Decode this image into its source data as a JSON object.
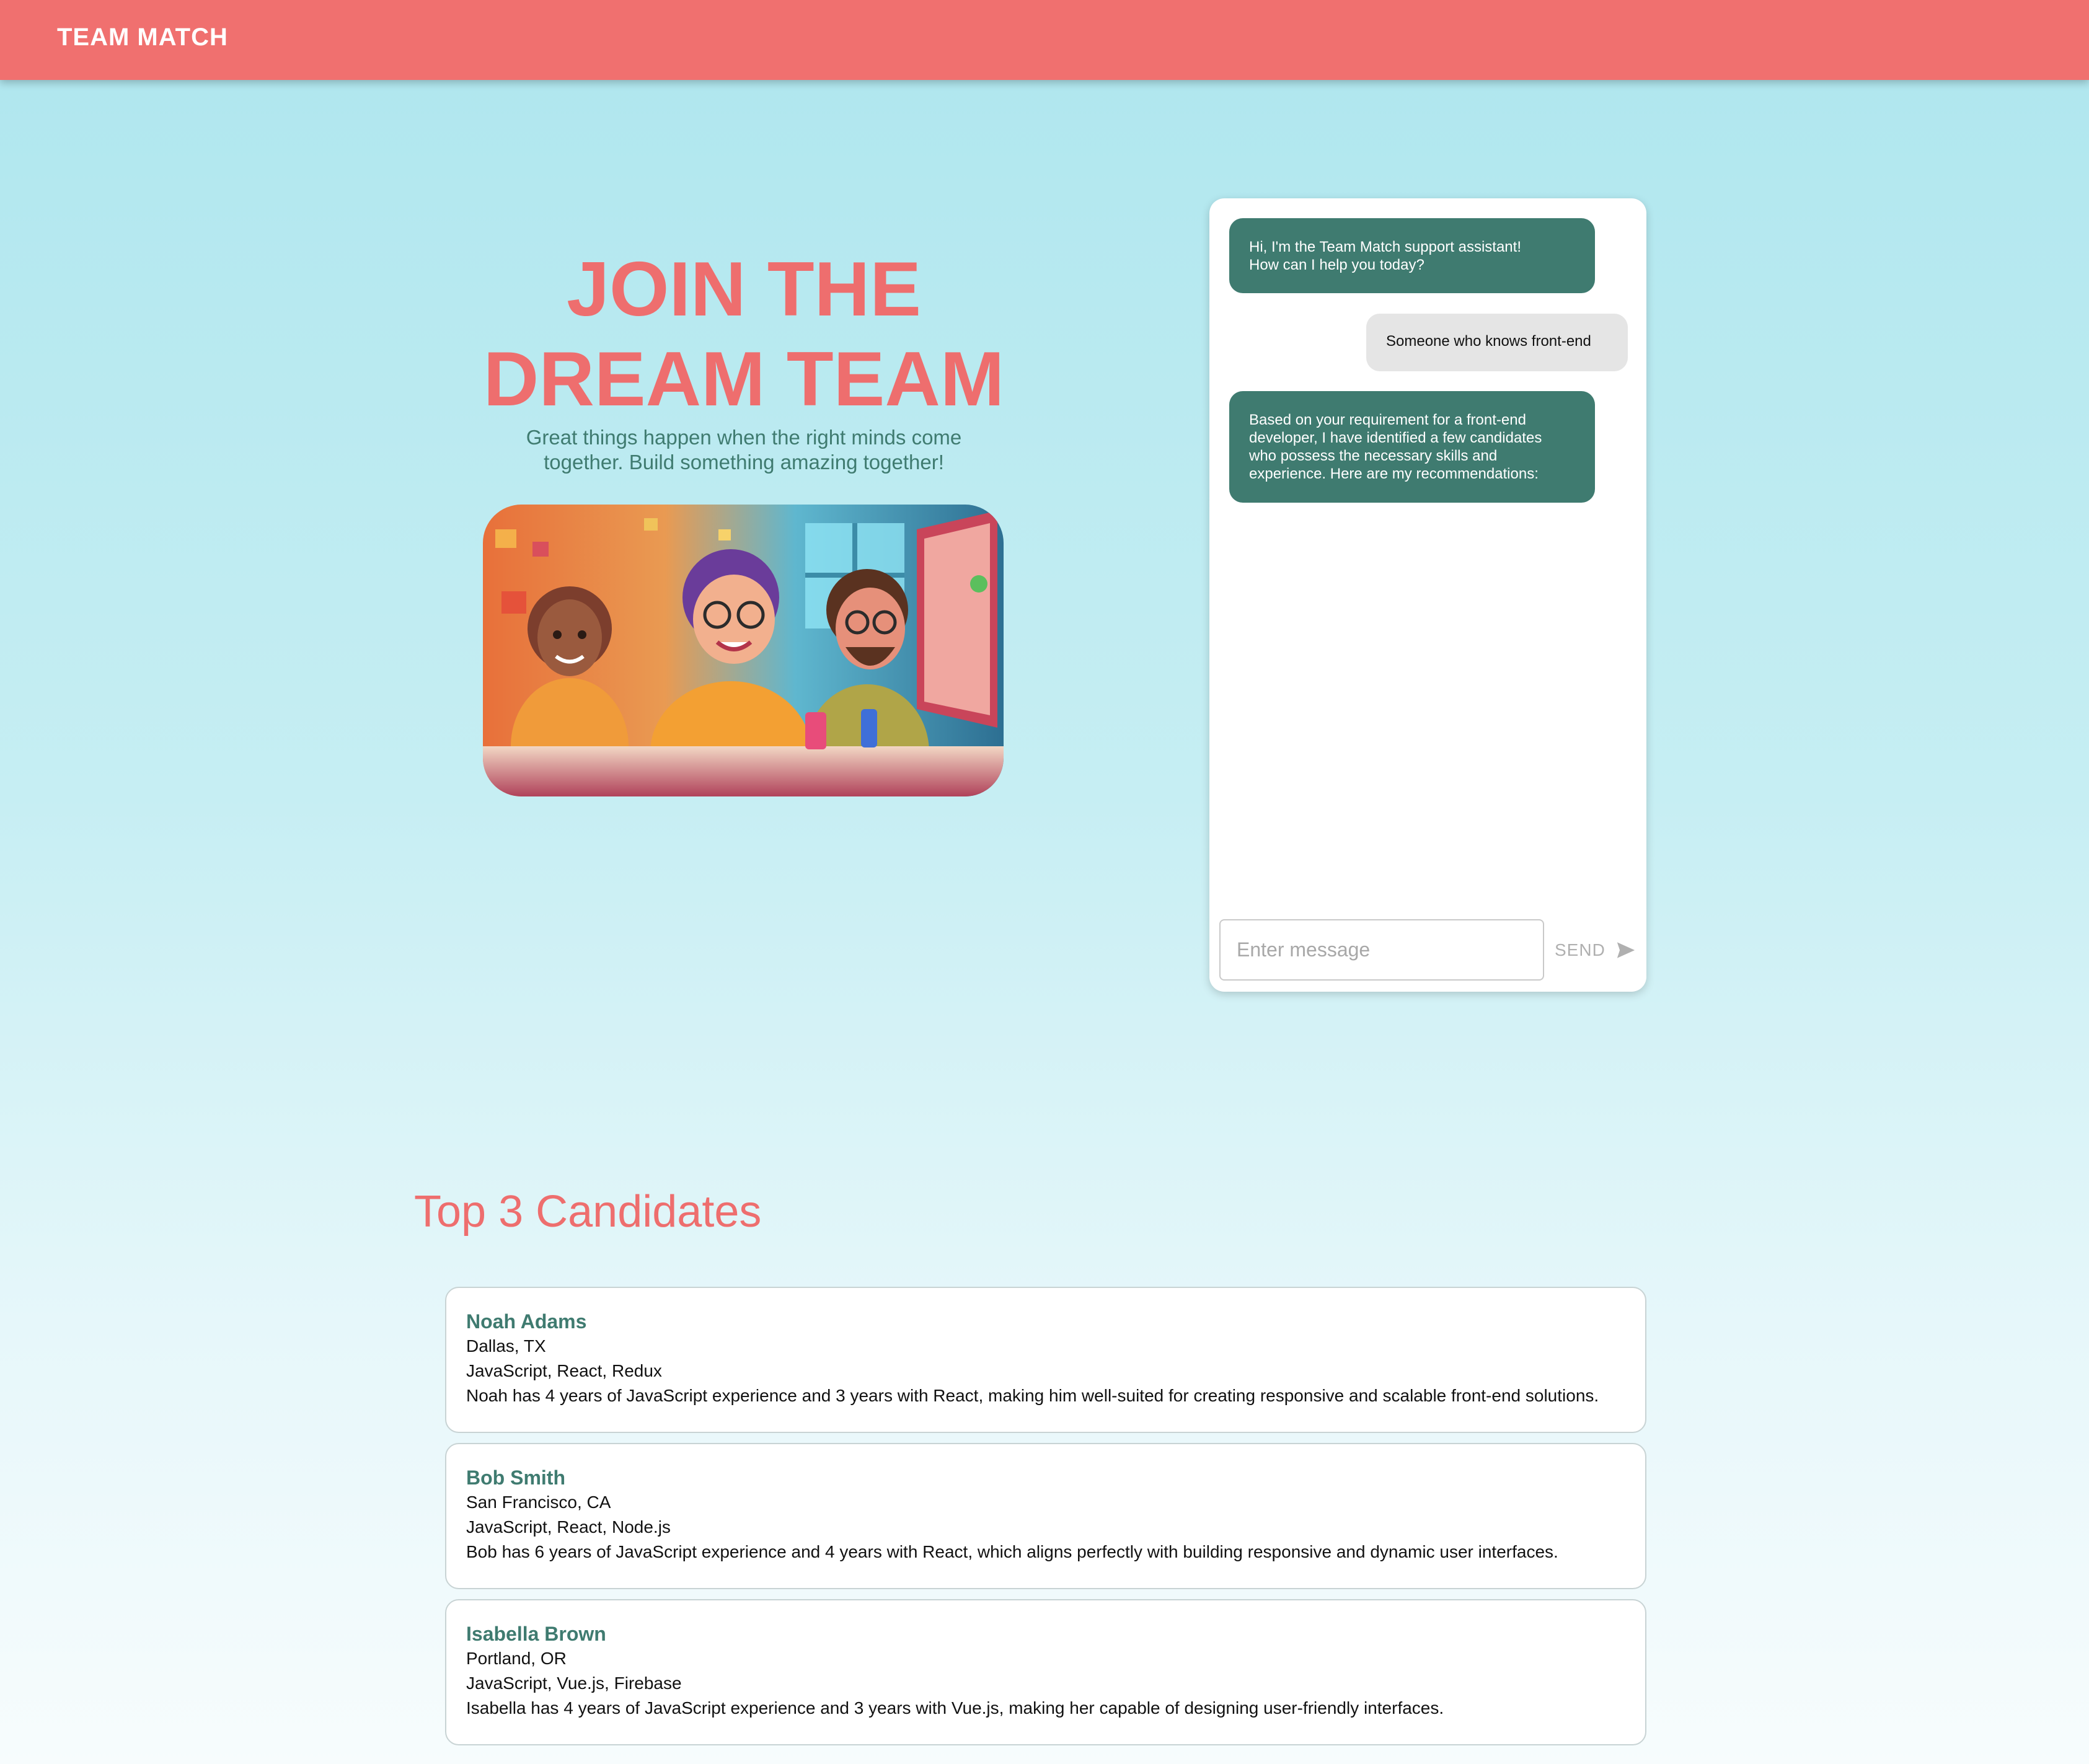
{
  "header": {
    "brand": "TEAM MATCH"
  },
  "hero": {
    "title_line1": "JOIN THE",
    "title_line2": "DREAM TEAM",
    "subtitle_line1": "Great things happen when the right minds come",
    "subtitle_line2": "together. Build something amazing together!"
  },
  "chat": {
    "messages": [
      {
        "role": "assistant",
        "line1": "Hi, I'm the Team Match support assistant!",
        "line2": "How can I help you today?"
      },
      {
        "role": "user",
        "text": "Someone who knows front-end"
      },
      {
        "role": "assistant",
        "line1": "Based on your requirement for a front-end",
        "line2": "developer, I have identified a few candidates",
        "line3": "who possess the necessary skills and",
        "line4": "experience. Here are my recommendations:"
      }
    ],
    "input_placeholder": "Enter message",
    "send_label": "SEND"
  },
  "candidates": {
    "title": "Top 3 Candidates",
    "items": [
      {
        "name": "Noah Adams",
        "location": "Dallas, TX",
        "skills": "JavaScript, React, Redux",
        "summary": "Noah has 4 years of JavaScript experience and 3 years with React, making him well-suited for creating responsive and scalable front-end solutions."
      },
      {
        "name": "Bob Smith",
        "location": "San Francisco, CA",
        "skills": "JavaScript, React, Node.js",
        "summary": "Bob has 6 years of JavaScript experience and 4 years with React, which aligns perfectly with building responsive and dynamic user interfaces."
      },
      {
        "name": "Isabella Brown",
        "location": "Portland, OR",
        "skills": "JavaScript, Vue.js, Firebase",
        "summary": "Isabella has 4 years of JavaScript experience and 3 years with Vue.js, making her capable of designing user-friendly interfaces."
      }
    ]
  },
  "colors": {
    "nav": "#f0706f",
    "accent_text": "#ee6e6e",
    "bot_bubble": "#3f7b70",
    "user_bubble": "#e5e5e5"
  },
  "icons": {
    "send": "send-icon",
    "illustration": "team-illustration"
  }
}
